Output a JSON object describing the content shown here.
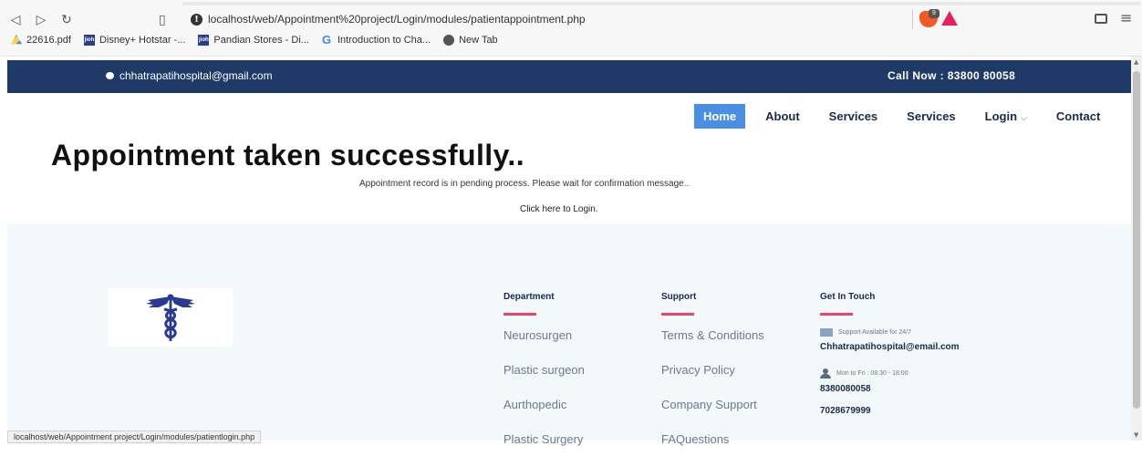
{
  "browser": {
    "url": "localhost/web/Appointment%20project/Login/modules/patientappointment.php",
    "bookmarks": [
      {
        "label": "22616.pdf",
        "icon": "drive-icon"
      },
      {
        "label": "Disney+ Hotstar -...",
        "icon": "site-icon"
      },
      {
        "label": "Pandian Stores - Di...",
        "icon": "site-icon"
      },
      {
        "label": "Introduction to Cha...",
        "icon": "google-icon"
      },
      {
        "label": "New Tab",
        "icon": "globe-icon"
      }
    ],
    "site_badge": "jioh",
    "brave_badge": "9",
    "status_url": "localhost/web/Appointment project/Login/modules/patientlogin.php"
  },
  "topbar": {
    "email": "chhatrapatihospital@gmail.com",
    "call": "Call Now : 83800 80058"
  },
  "nav": {
    "items": [
      "Home",
      "About",
      "Services",
      "Services",
      "Login",
      "Contact"
    ],
    "login_caret": "⌵"
  },
  "main": {
    "headline": "Appointment taken successfully..",
    "pending": "Appointment record is in pending process. Please wait for confirmation message..",
    "login_link": "Click here to Login."
  },
  "footer": {
    "department": {
      "title": "Department",
      "links": [
        "Neurosurgen",
        "Plastic surgeon",
        "Aurthopedic",
        "Plastic Surgery"
      ]
    },
    "support": {
      "title": "Support",
      "links": [
        "Terms & Conditions",
        "Privacy Policy",
        "Company Support",
        "FAQuestions"
      ]
    },
    "touch": {
      "title": "Get In Touch",
      "support_note": "Support Available for 24/7",
      "email": "Chhatrapatihospital@email.com",
      "hours": "Mon to Fri : 08:30 - 18:00",
      "phone1": "8380080058",
      "phone2": "7028679999"
    }
  },
  "colors": {
    "topbar": "#1f3a66",
    "active_nav": "#4a8fe3",
    "accent_underline": "#e8476a",
    "footer_bg": "#f3f8fb",
    "logo_blue": "#2b3990"
  }
}
